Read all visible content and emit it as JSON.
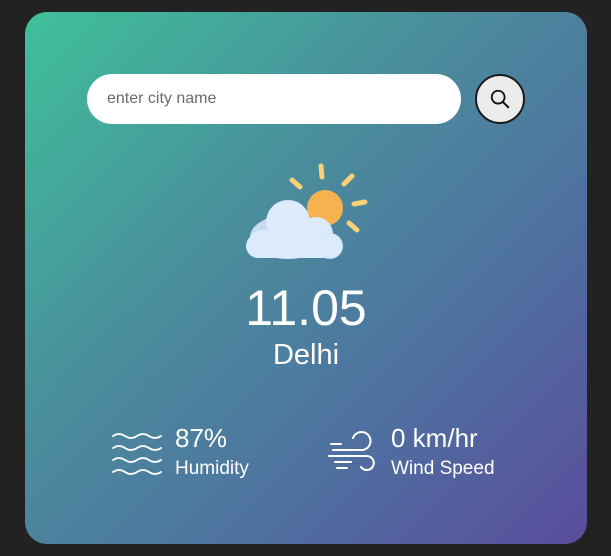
{
  "search": {
    "placeholder": "enter city name",
    "value": ""
  },
  "weather": {
    "icon": "partly-cloudy-icon",
    "temperature": "11.05",
    "city": "Delhi"
  },
  "details": {
    "humidity": {
      "value": "87%",
      "label": "Humidity",
      "icon": "humidity-waves-icon"
    },
    "wind": {
      "value": "0 km/hr",
      "label": "Wind Speed",
      "icon": "wind-icon"
    }
  },
  "colors": {
    "background": "#222222",
    "card_gradient_start": "#3fc09a",
    "card_gradient_end": "#5a4c9c",
    "sun": "#f6b24e",
    "sun_rays": "#f8d274",
    "cloud": "#dcebfb"
  }
}
